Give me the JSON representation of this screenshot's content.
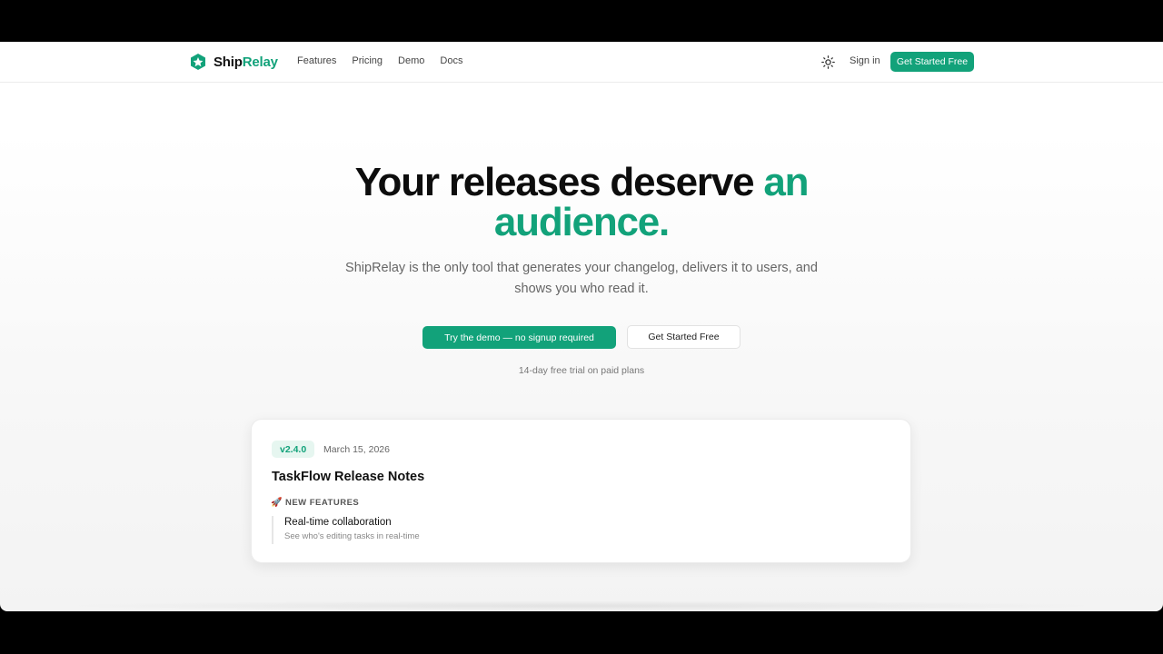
{
  "brand": {
    "name_part1": "Ship",
    "name_part2": "Relay",
    "icon": "hexagon-logo-icon",
    "accent_color": "#12a27a"
  },
  "nav": {
    "links": [
      {
        "label": "Features"
      },
      {
        "label": "Pricing"
      },
      {
        "label": "Demo"
      },
      {
        "label": "Docs"
      }
    ],
    "theme_icon": "sun-icon",
    "sign_in": "Sign in",
    "cta": "Get Started Free"
  },
  "hero": {
    "title_dark": "Your releases deserve ",
    "title_green_1": "an",
    "title_green_2": "audience.",
    "subtitle": "ShipRelay is the only tool that generates your changelog, delivers it to users, and shows you who read it.",
    "primary_button": "Try the demo — no signup required",
    "secondary_button": "Get Started Free",
    "note": "14-day free trial on paid plans"
  },
  "release_card": {
    "version": "v2.4.0",
    "date": "March 15, 2026",
    "title": "TaskFlow Release Notes",
    "section_icon": "rocket-icon",
    "section_label": "NEW FEATURES",
    "feature_title": "Real-time collaboration",
    "feature_desc": "See who's editing tasks in real-time"
  }
}
